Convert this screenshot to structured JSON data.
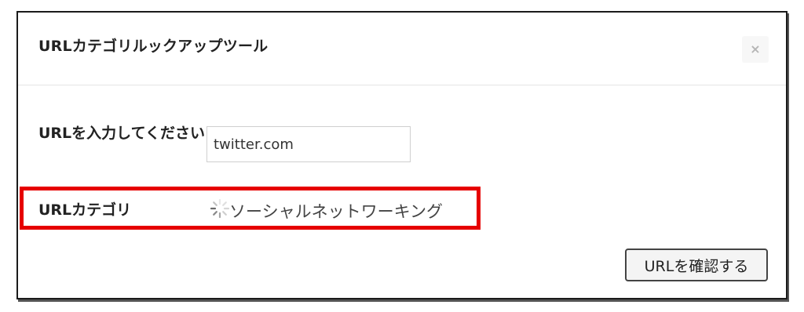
{
  "modal": {
    "title": "URLカテゴリルックアップツール",
    "close_symbol": "×"
  },
  "form": {
    "url_label": "URLを入力してください",
    "url_value": "twitter.com",
    "category_label": "URLカテゴリ",
    "category_value": "ソーシャルネットワーキング",
    "confirm_button": "URLを確認する"
  },
  "icons": {
    "close": "close-icon",
    "loading": "spinner-icon"
  },
  "colors": {
    "highlight_border": "#e60000"
  }
}
